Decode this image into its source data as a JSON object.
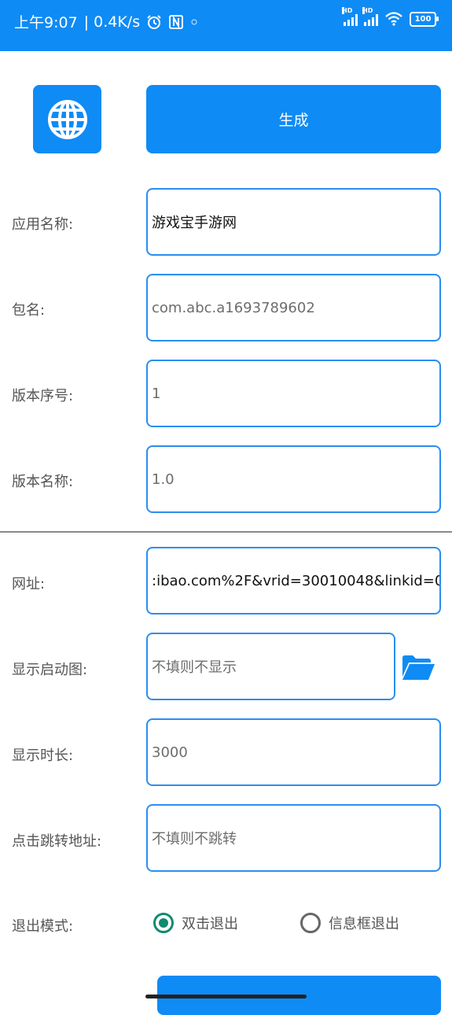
{
  "status_bar": {
    "time": "上午9:07",
    "speed": "| 0.4K/s",
    "signal1": "HD",
    "signal2": "HD",
    "battery": "100"
  },
  "header": {
    "icon": "globe-icon",
    "generate_label": "生成"
  },
  "form": {
    "app_name_label": "应用名称:",
    "app_name_value": "游戏宝手游网",
    "package_label": "包名:",
    "package_value": "com.abc.a1693789602",
    "version_code_label": "版本序号:",
    "version_code_value": "1",
    "version_name_label": "版本名称:",
    "version_name_value": "1.0",
    "url_label": "网址:",
    "url_value": ":ibao.com%2F&vrid=30010048&linkid=0",
    "splash_label": "显示启动图:",
    "splash_placeholder": "不填则不显示",
    "duration_label": "显示时长:",
    "duration_value": "3000",
    "jump_label": "点击跳转地址:",
    "jump_placeholder": "不填则不跳转",
    "exit_label": "退出模式:",
    "exit_options": [
      {
        "label": "双击退出",
        "selected": true
      },
      {
        "label": "信息框退出",
        "selected": false
      }
    ]
  },
  "colors": {
    "primary": "#0f8bf5",
    "border": "#2b8ef0",
    "radio_on": "#138a72"
  }
}
